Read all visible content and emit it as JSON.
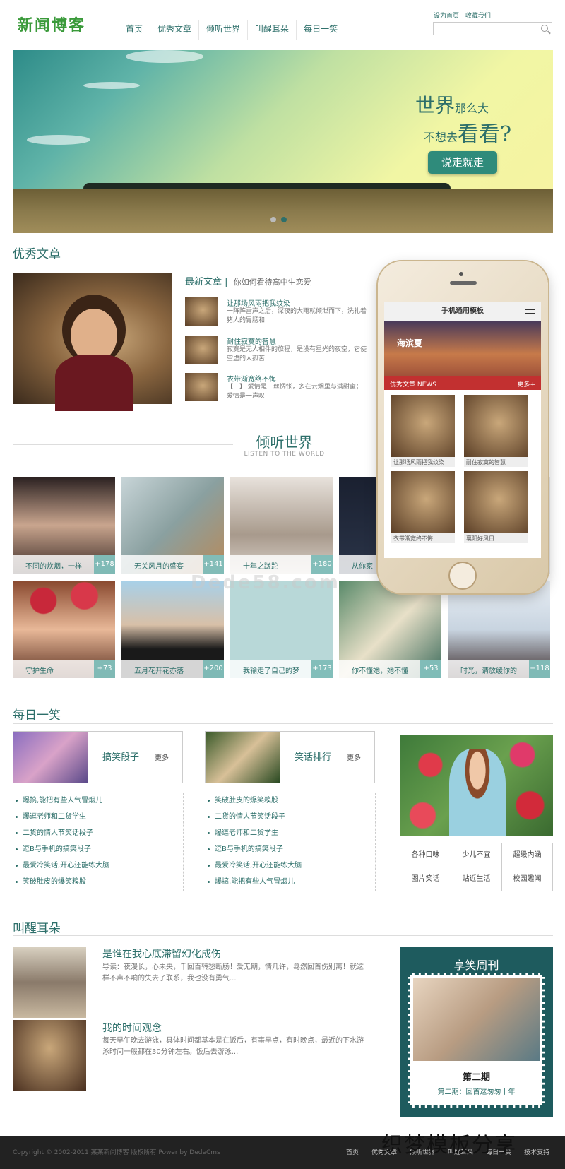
{
  "header": {
    "logo": "新闻博客",
    "nav": [
      "首页",
      "优秀文章",
      "倾听世界",
      "叫醒耳朵",
      "每日一笑"
    ],
    "toplinks": [
      "设为首页",
      "收藏我们"
    ],
    "search_placeholder": ""
  },
  "banner": {
    "line1_big": "世界",
    "line1_small": "那么大",
    "line2_small": "不想去",
    "line2_big": "看看?",
    "button": "说走就走"
  },
  "excellent": {
    "title": "优秀文章",
    "latest_label": "最新文章",
    "latest_sub": "你如何看待高中生恋爱",
    "articles": [
      {
        "title": "让那场风雨把我纹染",
        "desc": "一阵阵雷声之后，深夜的大雨就倾泄而下，洗礼着猪人的胃肠和"
      },
      {
        "title": "耐住寂寞的智慧",
        "desc": "寂寞是无人相伴的旅程，是没有星光的夜空，它使空虚的人孤苦"
      },
      {
        "title": "衣带渐宽终不悔",
        "desc": "【一】 爱情是一丝惆怅，多在云烟里与满甜蜜；爱情是一声叹"
      }
    ]
  },
  "world": {
    "title": "倾听世界",
    "subtitle": "LISTEN TO THE WORLD",
    "items": [
      {
        "cap": "不同的炊烟，一样",
        "num": "+178"
      },
      {
        "cap": "无关风月的盛宴",
        "num": "+141"
      },
      {
        "cap": "十年之蹉跎",
        "num": "+180"
      },
      {
        "cap": "从你家",
        "num": ""
      },
      {
        "cap": "",
        "num": ""
      },
      {
        "cap": "守护生命",
        "num": "+73"
      },
      {
        "cap": "五月花开花亦落",
        "num": "+200"
      },
      {
        "cap": "我输走了自己的梦",
        "num": "+173"
      },
      {
        "cap": "你不懂她，她不懂",
        "num": "+53"
      },
      {
        "cap": "时光，请放缓你的",
        "num": "+118"
      }
    ]
  },
  "phone": {
    "title": "手机通用模板",
    "banner_text": "海滨夏",
    "bar_label": "优秀文章",
    "bar_en": "NEWS",
    "more": "更多+",
    "caps": [
      "让那场风雨把我纹染",
      "耐住寂寞的智慧",
      "衣带渐宽终不悔",
      "襄阳好风日"
    ]
  },
  "watermark": "Dede58.com",
  "daily": {
    "title": "每日一笑",
    "box1": {
      "label": "搞笑段子",
      "more": "更多",
      "items": [
        "爆搞,能把有些人气冒烟儿",
        "爆逗老师和二货学生",
        "二货的情人节笑话段子",
        "逗B与手机的搞笑段子",
        "最爱冷笑话,开心还能练大脑",
        "笑破肚皮的爆笑糗股"
      ]
    },
    "box2": {
      "label": "笑话排行",
      "more": "更多",
      "items": [
        "笑破肚皮的爆笑糗股",
        "二货的情人节笑话段子",
        "爆逗老师和二货学生",
        "逗B与手机的搞笑段子",
        "最爱冷笑话,开心还能练大脑",
        "爆搞,能把有些人气冒烟儿"
      ]
    },
    "tags": [
      "各种口味",
      "少儿不宜",
      "超级内涵",
      "图片笑话",
      "贴近生活",
      "校园趣闻"
    ]
  },
  "ears": {
    "title": "叫醒耳朵",
    "news": [
      {
        "title": "是谁在我心底滞留幻化成伤",
        "desc": "导读：夜漫长，心未央，千回百转愁断肠！爱无期，情几许，蓦然回首伤别离！就这样不声不响的失去了联系，我也没有勇气..."
      },
      {
        "title": "我的时间观念",
        "desc": "每天早午晚去游泳，具体时间都基本是在饭后，有事早点，有时晚点，最近的下水游泳时间一般都在30分钟左右。饭后去游泳..."
      }
    ],
    "weekly": {
      "title": "享笑周刊",
      "issue": "第二期",
      "sub": "第二期：回首这匆匆十年"
    }
  },
  "footer": {
    "copy": "Copyright © 2002-2011 某某新闻博客 版权所有 Power by DedeCms",
    "links": [
      "首页",
      "优秀文章",
      "倾听世界",
      "叫醒耳朵",
      "每日一笑",
      "技术支持"
    ]
  },
  "corner_watermark": "织梦模板分享",
  "colors": {
    "accent": "#2d6f6a",
    "logo": "#3a9a3a",
    "phone_bar": "#c23030",
    "weekly_bg": "#1e5b5e"
  }
}
